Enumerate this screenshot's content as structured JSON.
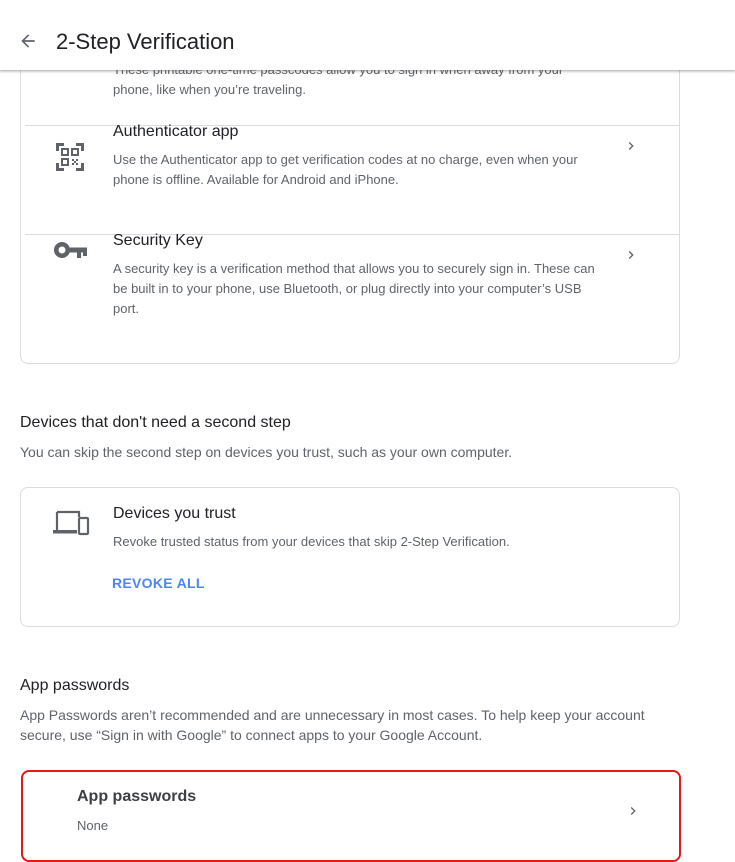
{
  "header": {
    "back_icon": "arrow-back-icon",
    "title": "2-Step Verification"
  },
  "backup_codes": {
    "desc_fragment": "These printable one-time passcodes allow you to sign in when away from your phone, like when you’re traveling."
  },
  "authenticator": {
    "icon": "qr-code-icon",
    "title": "Authenticator app",
    "desc": "Use the Authenticator app to get verification codes at no charge, even when your phone is offline. Available for Android and iPhone."
  },
  "security_key": {
    "icon": "key-icon",
    "title": "Security Key",
    "desc": "A security key is a verification method that allows you to securely sign in. These can be built in to your phone, use Bluetooth, or plug directly into your computer’s USB port."
  },
  "devices_section": {
    "heading": "Devices that don't need a second step",
    "desc": "You can skip the second step on devices you trust, such as your own computer.",
    "card": {
      "icon": "devices-icon",
      "title": "Devices you trust",
      "desc": "Revoke trusted status from your devices that skip 2-Step Verification.",
      "action": "REVOKE ALL"
    }
  },
  "app_passwords_section": {
    "heading": "App passwords",
    "desc": "App Passwords aren’t recommended and are unnecessary in most cases. To help keep your account secure, use “Sign in with Google” to connect apps to your Google Account.",
    "card": {
      "title": "App passwords",
      "value": "None"
    }
  },
  "colors": {
    "link": "#4b86f4",
    "highlight_border": "#e01919",
    "divider": "#dadce0"
  }
}
